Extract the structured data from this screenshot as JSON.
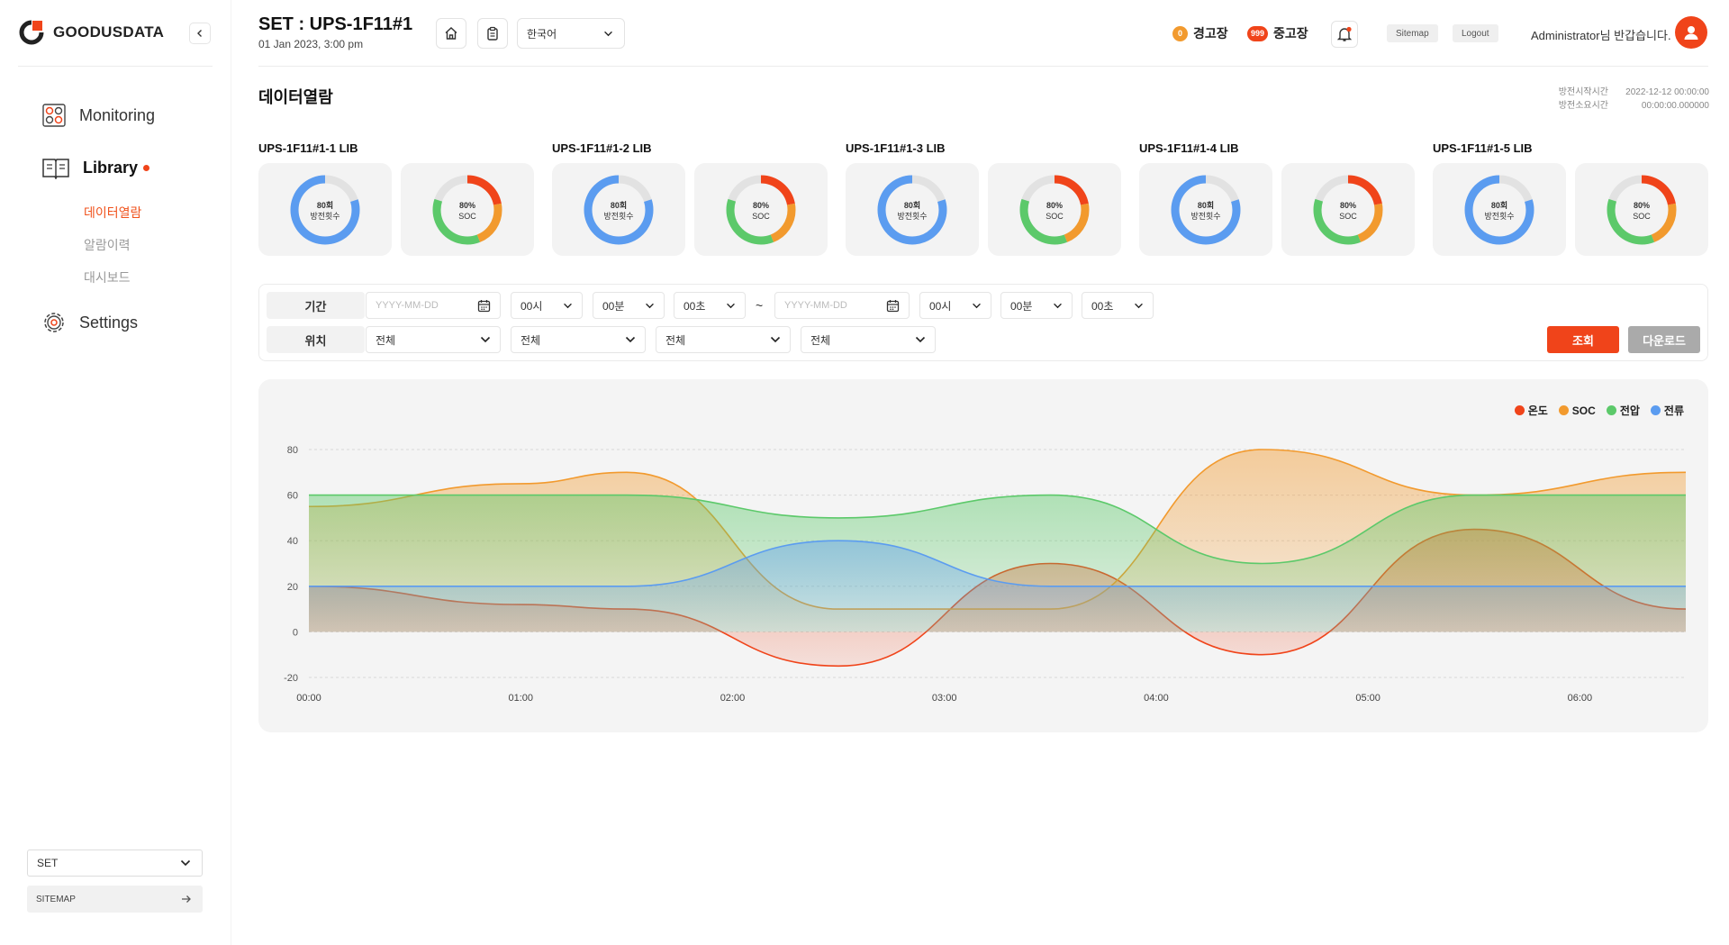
{
  "brand": {
    "name": "GOODUSDATA"
  },
  "sidebar": {
    "nav": [
      {
        "label": "Monitoring"
      },
      {
        "label": "Library"
      },
      {
        "label": "Settings"
      }
    ],
    "submenu": [
      {
        "label": "데이터열람"
      },
      {
        "label": "알람이력"
      },
      {
        "label": "대시보드"
      }
    ],
    "bottom_select": "SET",
    "sitemap": "SITEMAP"
  },
  "header": {
    "title": "SET : UPS-1F11#1",
    "date": "01 Jan 2023, 3:00 pm",
    "language": "한국어",
    "warning": {
      "count": "0",
      "label": "경고장",
      "color": "#f29a2e"
    },
    "fault": {
      "count": "999",
      "label": "중고장",
      "color": "#f0441a"
    },
    "sitemap": "Sitemap",
    "logout": "Logout",
    "greeting": "Administrator님 반갑습니다."
  },
  "page": {
    "title": "데이터열람",
    "meta": [
      {
        "label": "방전시작시간",
        "value": "2022-12-12 00:00:00"
      },
      {
        "label": "방전소요시간",
        "value": "00:00:00.000000"
      }
    ]
  },
  "batteries": [
    {
      "name": "UPS-1F11#1-1 LIB",
      "count_value": "80회",
      "count_label": "방전횟수",
      "soc_value": "80%",
      "soc_label": "SOC"
    },
    {
      "name": "UPS-1F11#1-2 LIB",
      "count_value": "80회",
      "count_label": "방전횟수",
      "soc_value": "80%",
      "soc_label": "SOC"
    },
    {
      "name": "UPS-1F11#1-3 LIB",
      "count_value": "80회",
      "count_label": "방전횟수",
      "soc_value": "80%",
      "soc_label": "SOC"
    },
    {
      "name": "UPS-1F11#1-4 LIB",
      "count_value": "80회",
      "count_label": "방전횟수",
      "soc_value": "80%",
      "soc_label": "SOC"
    },
    {
      "name": "UPS-1F11#1-5 LIB",
      "count_value": "80회",
      "count_label": "방전횟수",
      "soc_value": "80%",
      "soc_label": "SOC"
    }
  ],
  "filter": {
    "period_label": "기간",
    "location_label": "위치",
    "date_placeholder": "YYYY-MM-DD",
    "hour": "00시",
    "minute": "00분",
    "second": "00초",
    "tilde": "~",
    "location_all": "전체",
    "search_button": "조회",
    "download_button": "다운로드"
  },
  "colors": {
    "accent": "#f0441a",
    "temperature": "#f0441a",
    "soc": "#f29a2e",
    "voltage": "#5cc96a",
    "current": "#5b9cf0"
  },
  "chart_data": {
    "type": "area",
    "x": [
      "00:00",
      "01:00",
      "02:00",
      "03:00",
      "04:00",
      "05:00",
      "06:00"
    ],
    "ylim": [
      -20,
      80
    ],
    "yticks": [
      80,
      60,
      40,
      20,
      0,
      -20
    ],
    "grid": true,
    "legend_position": "top-right",
    "series": [
      {
        "name": "온도",
        "color": "#f0441a",
        "points": [
          [
            "00:00",
            20
          ],
          [
            "01:00",
            12
          ],
          [
            "01:30",
            10
          ],
          [
            "02:30",
            -15
          ],
          [
            "03:30",
            30
          ],
          [
            "04:30",
            -10
          ],
          [
            "05:30",
            45
          ],
          [
            "06:30",
            10
          ]
        ]
      },
      {
        "name": "SOC",
        "color": "#f29a2e",
        "points": [
          [
            "00:00",
            55
          ],
          [
            "01:00",
            65
          ],
          [
            "01:30",
            70
          ],
          [
            "02:30",
            10
          ],
          [
            "03:00",
            10
          ],
          [
            "03:30",
            10
          ],
          [
            "04:30",
            80
          ],
          [
            "05:30",
            60
          ],
          [
            "06:30",
            70
          ]
        ]
      },
      {
        "name": "전압",
        "color": "#5cc96a",
        "points": [
          [
            "00:00",
            60
          ],
          [
            "01:30",
            60
          ],
          [
            "02:30",
            50
          ],
          [
            "03:30",
            60
          ],
          [
            "04:30",
            30
          ],
          [
            "05:30",
            60
          ],
          [
            "06:30",
            60
          ]
        ]
      },
      {
        "name": "전류",
        "color": "#5b9cf0",
        "points": [
          [
            "00:00",
            20
          ],
          [
            "01:30",
            20
          ],
          [
            "02:30",
            40
          ],
          [
            "03:30",
            20
          ],
          [
            "06:30",
            20
          ]
        ]
      }
    ]
  }
}
